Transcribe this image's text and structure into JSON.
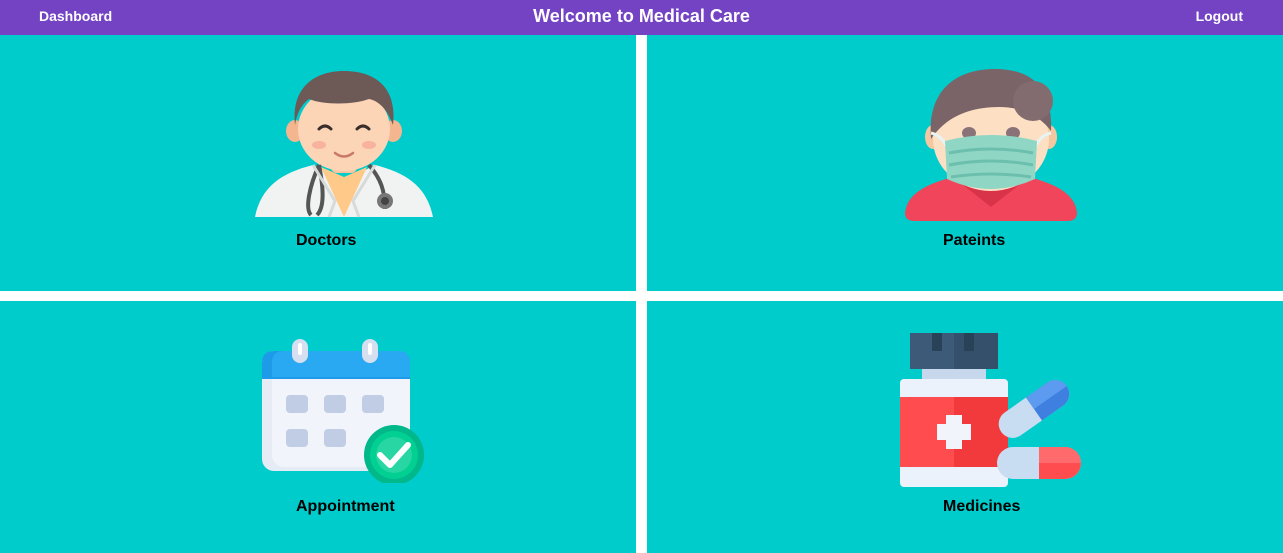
{
  "header": {
    "dashboard_label": "Dashboard",
    "title": "Welcome to Medical Care",
    "logout_label": "Logout"
  },
  "tiles": [
    {
      "label": "Doctors",
      "icon": "doctor-icon"
    },
    {
      "label": "Pateints",
      "icon": "masked-patient-icon"
    },
    {
      "label": "Appointment",
      "icon": "calendar-check-icon"
    },
    {
      "label": "Medicines",
      "icon": "medicine-bottle-pills-icon"
    }
  ],
  "colors": {
    "header_bg": "#7443c4",
    "tile_bg": "#00cccc",
    "divider": "#ffffff"
  }
}
